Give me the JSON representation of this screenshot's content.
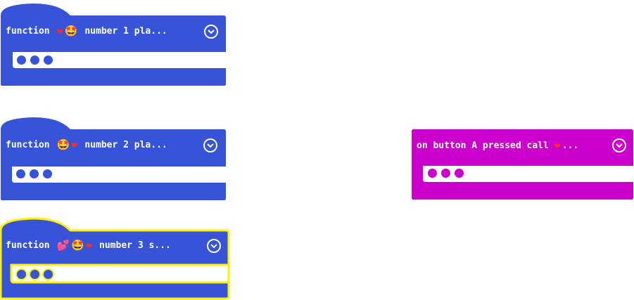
{
  "colors": {
    "function_block": "#3754d8",
    "event_block": "#cc00cc",
    "selected_outline": "#fff200"
  },
  "blocks": [
    {
      "keyword": "function",
      "icons": [
        "heart",
        "star-struck-face"
      ],
      "name_text": "number 1  pla..."
    },
    {
      "keyword": "function",
      "icons": [
        "star-struck-face",
        "heart"
      ],
      "name_text": "number 2  pla..."
    },
    {
      "keyword": "function",
      "icons": [
        "two-hearts",
        "star-struck-face",
        "heart"
      ],
      "name_text": "number 3  s..."
    },
    {
      "text": "on button A pressed call ",
      "icons": [
        "heart"
      ],
      "suffix": "..."
    }
  ],
  "glyphs": {
    "heart": "❤",
    "star_struck_face": "🤩",
    "two_hearts": "💕"
  }
}
